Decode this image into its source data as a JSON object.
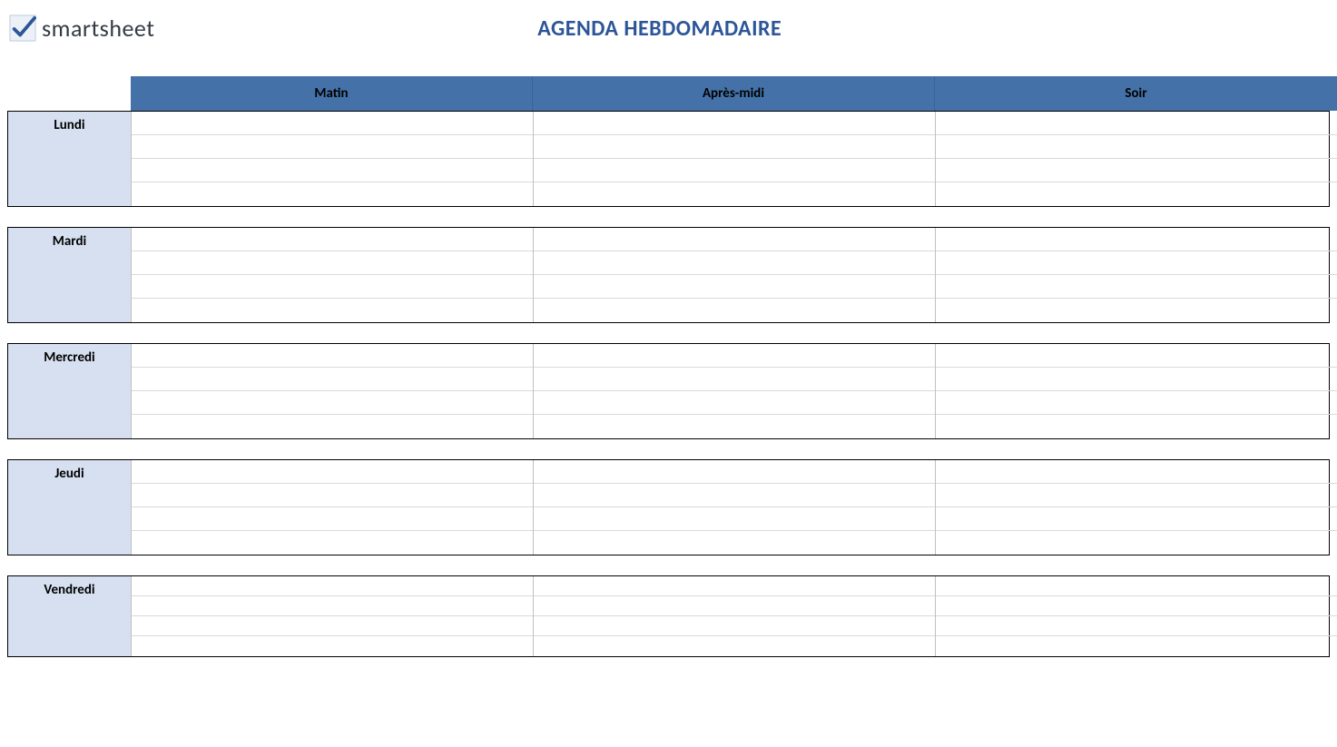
{
  "brand": "smartsheet",
  "title": "AGENDA HEBDOMADAIRE",
  "columns": [
    "Matin",
    "Après-midi",
    "Soir"
  ],
  "days": [
    {
      "label": "Lundi",
      "rows": [
        "",
        "",
        "",
        ""
      ]
    },
    {
      "label": "Mardi",
      "rows": [
        "",
        "",
        "",
        ""
      ]
    },
    {
      "label": "Mercredi",
      "rows": [
        "",
        "",
        "",
        ""
      ]
    },
    {
      "label": "Jeudi",
      "rows": [
        "",
        "",
        "",
        ""
      ]
    },
    {
      "label": "Vendredi",
      "rows": [
        "",
        "",
        "",
        ""
      ]
    }
  ]
}
